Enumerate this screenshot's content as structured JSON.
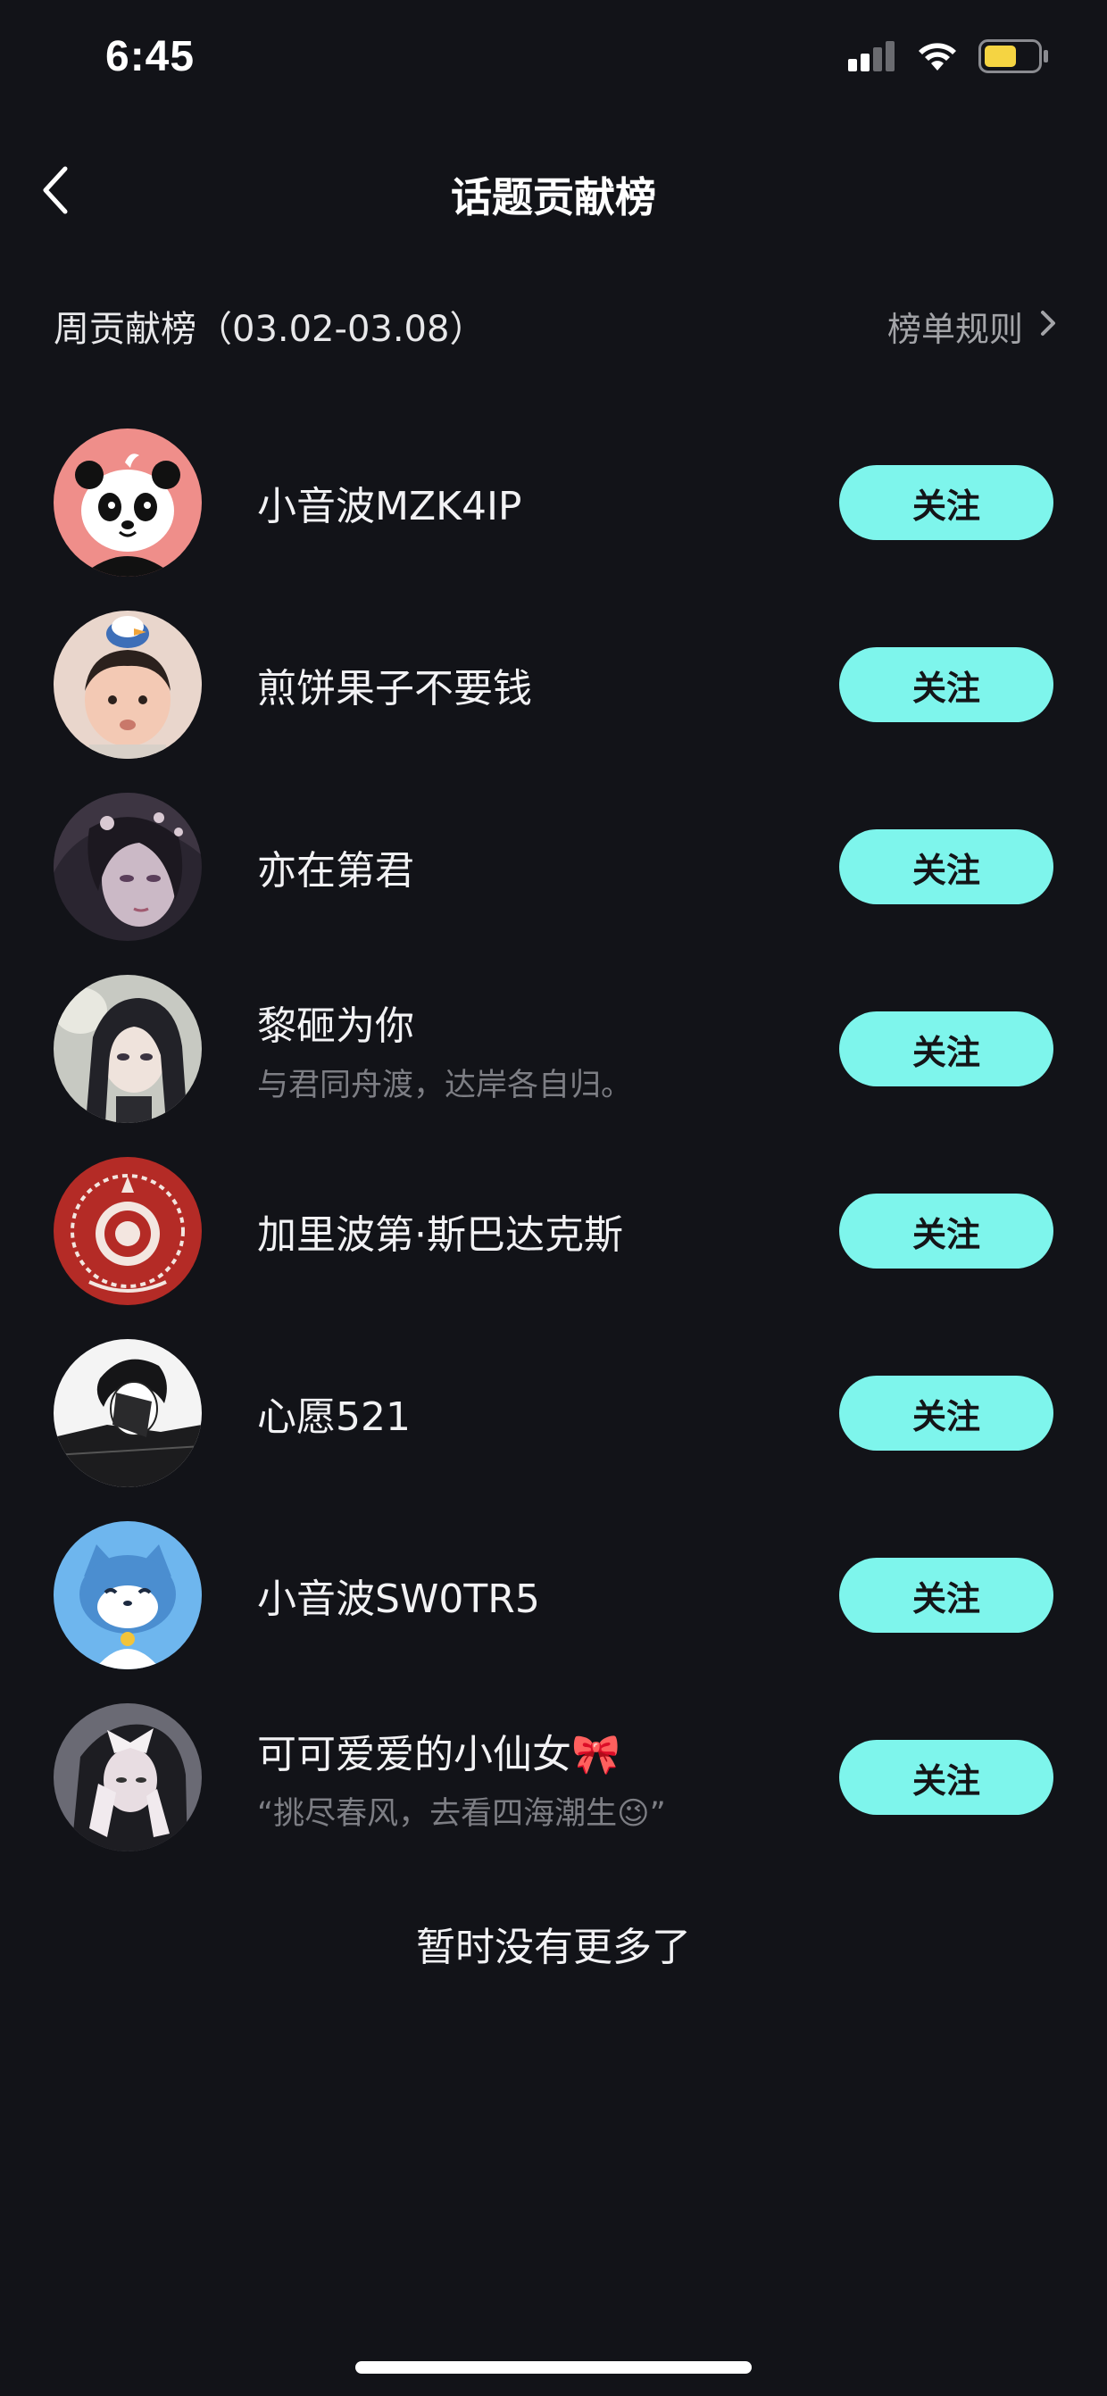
{
  "status_bar": {
    "time": "6:45",
    "battery_color": "#f5d442"
  },
  "nav": {
    "title": "话题贡献榜"
  },
  "section": {
    "title": "周贡献榜（03.02-03.08）",
    "rules_label": "榜单规则"
  },
  "users": [
    {
      "name": "小音波MZK4IP",
      "bio": "",
      "follow_label": "关注",
      "avatar": "panda-avatar"
    },
    {
      "name": "煎饼果子不要钱",
      "bio": "",
      "follow_label": "关注",
      "avatar": "baby-photo-avatar"
    },
    {
      "name": "亦在第君",
      "bio": "",
      "follow_label": "关注",
      "avatar": "anime-girl-avatar"
    },
    {
      "name": "黎砸为你",
      "bio": "与君同舟渡，达岸各自归。",
      "follow_label": "关注",
      "avatar": "anime-girl-dark-hair-avatar"
    },
    {
      "name": "加里波第·斯巴达克斯",
      "bio": "",
      "follow_label": "关注",
      "avatar": "red-emblem-avatar"
    },
    {
      "name": "心愿521",
      "bio": "",
      "follow_label": "关注",
      "avatar": "sketch-boy-avatar"
    },
    {
      "name": "小音波SW0TR5",
      "bio": "",
      "follow_label": "关注",
      "avatar": "blue-cat-avatar"
    },
    {
      "name": "可可爱爱的小仙女🎀",
      "bio": "“挑尽春风，去看四海潮生😉”",
      "follow_label": "关注",
      "avatar": "girl-with-bow-avatar"
    }
  ],
  "footer": {
    "end_text": "暂时没有更多了"
  },
  "colors": {
    "background": "#121318",
    "accent": "#7ef5ec"
  }
}
